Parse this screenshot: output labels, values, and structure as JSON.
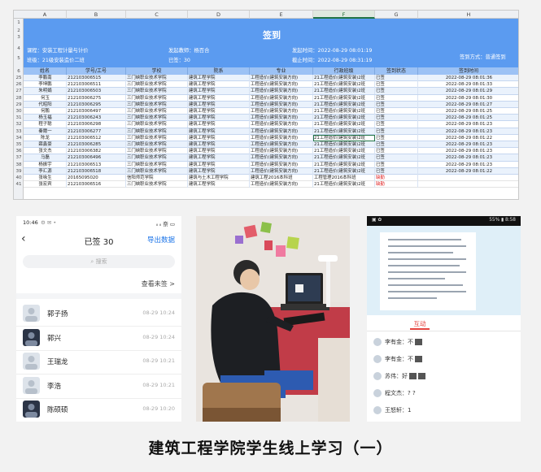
{
  "sheet": {
    "columns": [
      "A",
      "B",
      "C",
      "D",
      "E",
      "F",
      "G",
      "H"
    ],
    "selected_column": "F",
    "row_numbers": [
      "1",
      "2",
      "3",
      "4",
      "5",
      "6",
      "25",
      "26",
      "27",
      "28",
      "29",
      "30",
      "31",
      "32",
      "33",
      "34",
      "35",
      "36",
      "37",
      "38",
      "39",
      "40",
      "41"
    ],
    "title": "签到",
    "meta": {
      "course": "课程：安装工程计量与计价",
      "teacher": "发起教师：杨百合",
      "start_time": "发起时间：2022-08-29 08:01:19",
      "class": "班级：21级安装造价二班",
      "signed": "已签：30",
      "end_time": "截止时间：2022-08-29 08:31:19",
      "method": "签到方式：普通签到"
    },
    "headers": [
      "姓名",
      "学号/工号",
      "学校",
      "院系",
      "专业",
      "行政班级",
      "签到状态",
      "签到时间"
    ],
    "rows": [
      [
        "李鹏南",
        "212103006515",
        "三门峡职业技术学院",
        "建筑工程学院",
        "工程造价(建筑安装方向)",
        "21工程造价(建筑安装)2班",
        "已签",
        "2022-08-29 08:01:36"
      ],
      [
        "李坤鹏",
        "212103006511",
        "三门峡职业技术学院",
        "建筑工程学院",
        "工程造价(建筑安装方向)",
        "21工程造价(建筑安装)2班",
        "已签",
        "2022-08-29 08:01:33"
      ],
      [
        "朱明娟",
        "212103006503",
        "三门峡职业技术学院",
        "建筑工程学院",
        "工程造价(建筑安装方向)",
        "21工程造价(建筑安装)2班",
        "已签",
        "2022-08-29 08:01:29"
      ],
      [
        "何玉",
        "212103006275",
        "三门峡职业技术学院",
        "建筑工程学院",
        "工程造价(建筑安装方向)",
        "21工程造价(建筑安装)2班",
        "已签",
        "2022-08-29 08:01:30"
      ],
      [
        "代昭阳",
        "212103006295",
        "三门峡职业技术学院",
        "建筑工程学院",
        "工程造价(建筑安装方向)",
        "21工程造价(建筑安装)2班",
        "已签",
        "2022-08-29 08:01:27"
      ],
      [
        "何鹏",
        "212103006497",
        "三门峡职业技术学院",
        "建筑工程学院",
        "工程造价(建筑安装方向)",
        "21工程造价(建筑安装)2班",
        "已签",
        "2022-08-29 08:01:25"
      ],
      [
        "杨玉福",
        "212103006243",
        "三门峡职业技术学院",
        "建筑工程学院",
        "工程造价(建筑安装方向)",
        "21工程造价(建筑安装)2班",
        "已签",
        "2022-08-29 08:01:25"
      ],
      [
        "程子聪",
        "212103006298",
        "三门峡职业技术学院",
        "建筑工程学院",
        "工程造价(建筑安装方向)",
        "21工程造价(建筑安装)2班",
        "已签",
        "2022-08-29 08:01:23"
      ],
      [
        "秦爾一",
        "212103006277",
        "三门峡职业技术学院",
        "建筑工程学院",
        "工程造价(建筑安装方向)",
        "21工程造价(建筑安装)2班",
        "已签",
        "2022-08-29 08:01:23"
      ],
      [
        "陈龙",
        "212103006512",
        "三门峡职业技术学院",
        "建筑工程学院",
        "工程造价(建筑安装方向)",
        "21工程造价(建筑安装)2班",
        "已签",
        "2022-08-29 08:01:22"
      ],
      [
        "薛鑫豪",
        "212103006285",
        "三门峡职业技术学院",
        "建筑工程学院",
        "工程造价(建筑安装方向)",
        "21工程造价(建筑安装)2班",
        "已签",
        "2022-08-29 08:01:23"
      ],
      [
        "张文杰",
        "212103006382",
        "三门峡职业技术学院",
        "建筑工程学院",
        "工程造价(建筑安装方向)",
        "21工程造价(建筑安装)2班",
        "已签",
        "2022-08-29 08:01:23"
      ],
      [
        "马磊",
        "212103006496",
        "三门峡职业技术学院",
        "建筑工程学院",
        "工程造价(建筑安装方向)",
        "21工程造价(建筑安装)2班",
        "已签",
        "2022-08-29 08:01:23"
      ],
      [
        "杨振宇",
        "212103006513",
        "三门峡职业技术学院",
        "建筑工程学院",
        "工程造价(建筑安装方向)",
        "21工程造价(建筑安装)2班",
        "已签",
        "2022-08-29 08:01:23"
      ],
      [
        "李汇源",
        "212103006518",
        "三门峡职业技术学院",
        "建筑工程学院",
        "工程造价(建筑安装方向)",
        "21工程造价(建筑安装)2班",
        "已签",
        "2022-08-29 08:01:22"
      ],
      [
        "张咏生",
        "20165095020",
        "信阳师范学院",
        "建筑与土木工程学院",
        "建筑工程2016本科班",
        "工程管理2016本科班",
        "缺勤",
        ""
      ],
      [
        "张宏宾",
        "212103006516",
        "三门峡职业技术学院",
        "建筑工程学院",
        "工程造价(建筑安装方向)",
        "21工程造价(建筑安装)2班",
        "缺勤",
        ""
      ]
    ]
  },
  "phone": {
    "time": "10:46",
    "status_icons": "⚙ ✉ •",
    "signal": "ᵢₗ ᵢₗ 奈 ▭",
    "title": "已签 30",
    "export_label": "导出数据",
    "search_placeholder": "搜索",
    "view_unsigned": "查看未签 >",
    "students": [
      {
        "name": "郭子扬",
        "time": "08-29 10:24"
      },
      {
        "name": "郭兴",
        "time": "08-29 10:24"
      },
      {
        "name": "王瑞龙",
        "time": "08-29 10:21"
      },
      {
        "name": "李浩",
        "time": "08-29 10:21"
      },
      {
        "name": "陈硕硕",
        "time": "08-29 10:20"
      }
    ]
  },
  "tablet": {
    "status_left": "▣ ✿",
    "status_right": "55% ▮ 8:58",
    "interact_tab": "互动",
    "messages": [
      {
        "sender": "李有金：不"
      },
      {
        "sender": "李有金：不"
      },
      {
        "sender": "苏伟：好"
      },
      {
        "sender": "程文杰：? ?"
      },
      {
        "sender": "王怒轩：1"
      }
    ]
  },
  "caption": "建筑工程学院学生线上学习（一）"
}
